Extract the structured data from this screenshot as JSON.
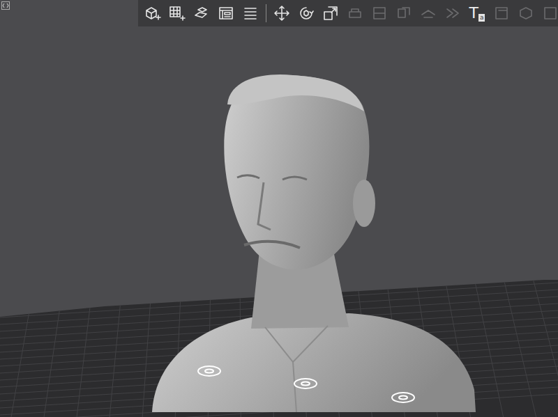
{
  "toolbar": {
    "buttons": [
      {
        "kind": "button",
        "disabled": false
      },
      {
        "kind": "button",
        "disabled": false
      },
      {
        "kind": "button",
        "disabled": false
      },
      {
        "kind": "button",
        "disabled": false
      },
      {
        "kind": "button",
        "disabled": false
      },
      {
        "kind": "separator",
        "disabled": false
      },
      {
        "kind": "button",
        "disabled": false
      },
      {
        "kind": "button",
        "disabled": false
      },
      {
        "kind": "button",
        "disabled": false
      },
      {
        "kind": "button",
        "disabled": true
      },
      {
        "kind": "button",
        "disabled": true
      },
      {
        "kind": "button",
        "disabled": true
      },
      {
        "kind": "button",
        "disabled": true
      },
      {
        "kind": "button",
        "disabled": true
      },
      {
        "kind": "text",
        "glyph": "T",
        "sub": "a",
        "disabled": false
      },
      {
        "kind": "button",
        "disabled": true
      },
      {
        "kind": "button",
        "disabled": true
      },
      {
        "kind": "button",
        "disabled": true
      }
    ]
  }
}
